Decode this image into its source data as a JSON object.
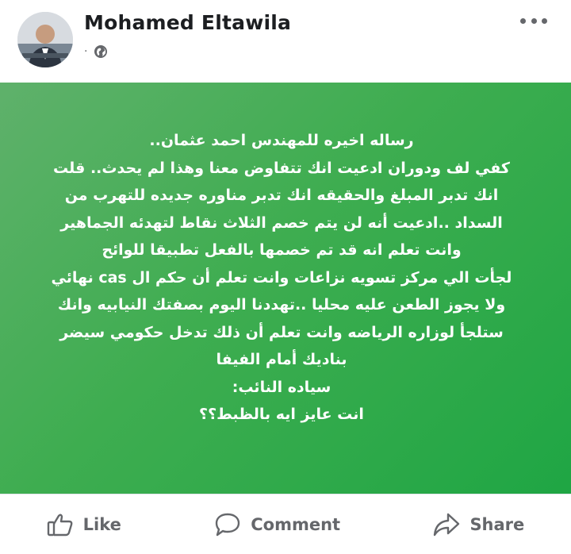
{
  "post": {
    "author": "Mohamed Eltawila",
    "meta_separator": "·",
    "privacy_icon": "globe-icon",
    "more_icon": "more-options-icon",
    "background": {
      "start": "#5fb16b",
      "end": "#1fa644"
    },
    "lines": [
      "رساله اخيره للمهندس احمد عثمان..",
      "كفي لف ودوران ادعيت انك تتفاوض معنا وهذا لم يحدث.. قلت",
      "انك تدبر المبلغ والحقيقه انك تدبر  مناوره جديده للتهرب من",
      "السداد ..ادعيت أنه لن يتم خصم الثلاث نقاط  لتهدئه الجماهير",
      "وانت تعلم انه قد تم خصمها بالفعل تطبيقا للوائح",
      "لجأت الي مركز تسويه نزاعات وانت تعلم أن حكم ال cas نهائي",
      "ولا يجوز الطعن عليه محليا ..تهددنا اليوم بصفتك النيابيه وانك",
      "ستلجأ لوزاره الرياضه  وانت تعلم أن ذلك تدخل حكومي سيضر",
      "بناديك أمام الفيفا",
      "سياده النائب:",
      "انت عايز ايه بالظبط؟؟"
    ]
  },
  "actions": {
    "like": {
      "label": "Like",
      "icon": "thumbs-up-icon"
    },
    "comment": {
      "label": "Comment",
      "icon": "comment-icon"
    },
    "share": {
      "label": "Share",
      "icon": "share-icon"
    }
  },
  "colors": {
    "text_secondary": "#65676b",
    "author": "#1c1e21"
  }
}
